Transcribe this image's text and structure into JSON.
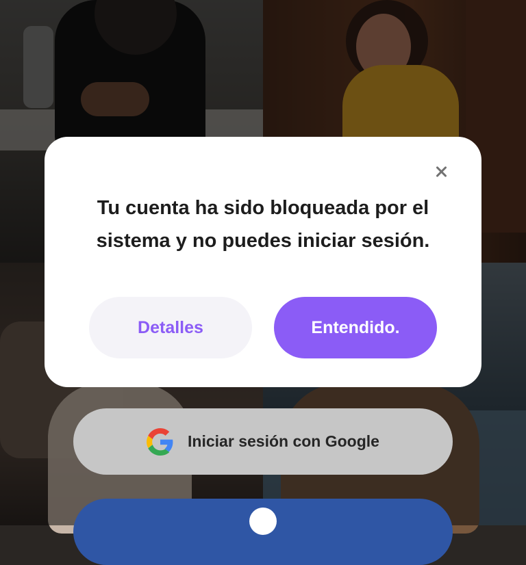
{
  "dialog": {
    "message": "Tu cuenta ha sido bloqueada por el sistema y no puedes iniciar sesión.",
    "details_button": "Detalles",
    "ok_button": "Entendido.",
    "close_icon": "close-icon"
  },
  "login": {
    "google_label": "Iniciar sesión con Google",
    "google_icon": "google-icon",
    "facebook_icon": "facebook-icon"
  },
  "colors": {
    "accent": "#8b5cf6",
    "secondary_button_bg": "#f4f3f8",
    "facebook_blue": "#2f56a5",
    "google_button_bg": "#c6c6c6"
  }
}
